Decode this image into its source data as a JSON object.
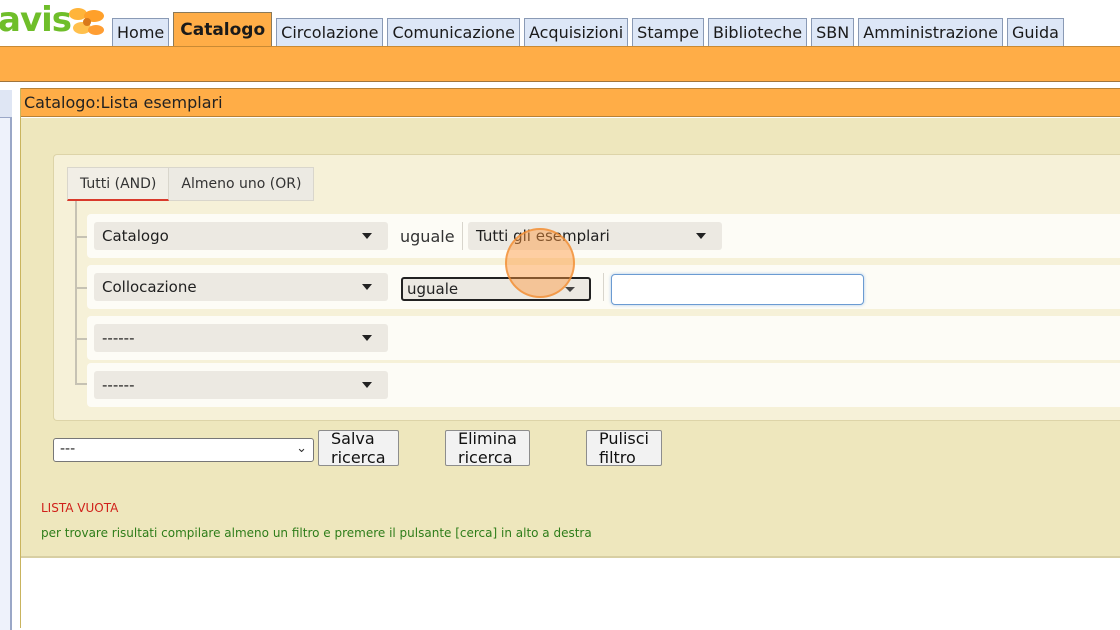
{
  "app": {
    "logo_text": "avis",
    "brand_green": "#6fbe2a",
    "accent_orange": "#ffad47"
  },
  "nav": {
    "tabs": [
      {
        "label": "Home",
        "active": false
      },
      {
        "label": "Catalogo",
        "active": true
      },
      {
        "label": "Circolazione",
        "active": false
      },
      {
        "label": "Comunicazione",
        "active": false
      },
      {
        "label": "Acquisizioni",
        "active": false
      },
      {
        "label": "Stampe",
        "active": false
      },
      {
        "label": "Biblioteche",
        "active": false
      },
      {
        "label": "SBN",
        "active": false
      },
      {
        "label": "Amministrazione",
        "active": false
      },
      {
        "label": "Guida",
        "active": false
      }
    ]
  },
  "panel": {
    "title": "Catalogo:Lista esemplari"
  },
  "filters": {
    "logic_tabs": [
      {
        "label": "Tutti (AND)",
        "active": true
      },
      {
        "label": "Almeno uno (OR)",
        "active": false
      }
    ],
    "rows": [
      {
        "field": "Catalogo",
        "operator_text": "uguale",
        "value": "Tutti gli esemplari"
      },
      {
        "field": "Collocazione",
        "operator": "uguale",
        "input_value": ""
      },
      {
        "field": "------"
      },
      {
        "field": "------"
      }
    ]
  },
  "actions": {
    "saved_search": "---",
    "save_label": "Salva ricerca",
    "delete_label": "Elimina ricerca",
    "clear_label": "Pulisci filtro"
  },
  "messages": {
    "empty": "LISTA VUOTA",
    "hint": "per trovare risultati compilare almeno un filtro e premere il pulsante [cerca] in alto a destra"
  }
}
